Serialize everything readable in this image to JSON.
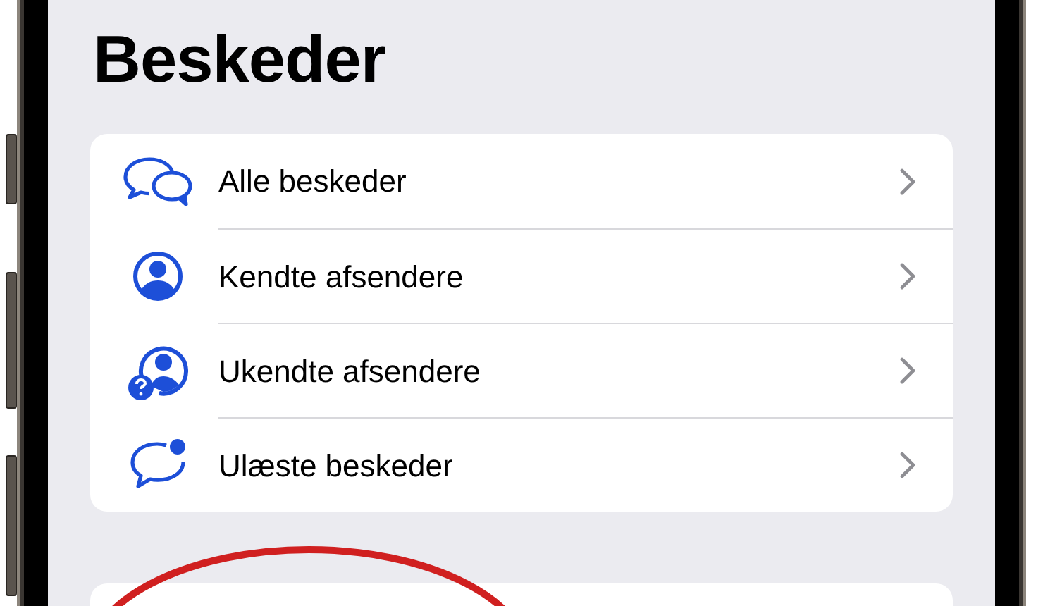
{
  "title": "Beskeder",
  "filters": [
    {
      "label": "Alle beskeder",
      "kind": "all"
    },
    {
      "label": "Kendte afsendere",
      "kind": "known"
    },
    {
      "label": "Ukendte afsendere",
      "kind": "unknown"
    },
    {
      "label": "Ulæste beskeder",
      "kind": "unread"
    }
  ]
}
